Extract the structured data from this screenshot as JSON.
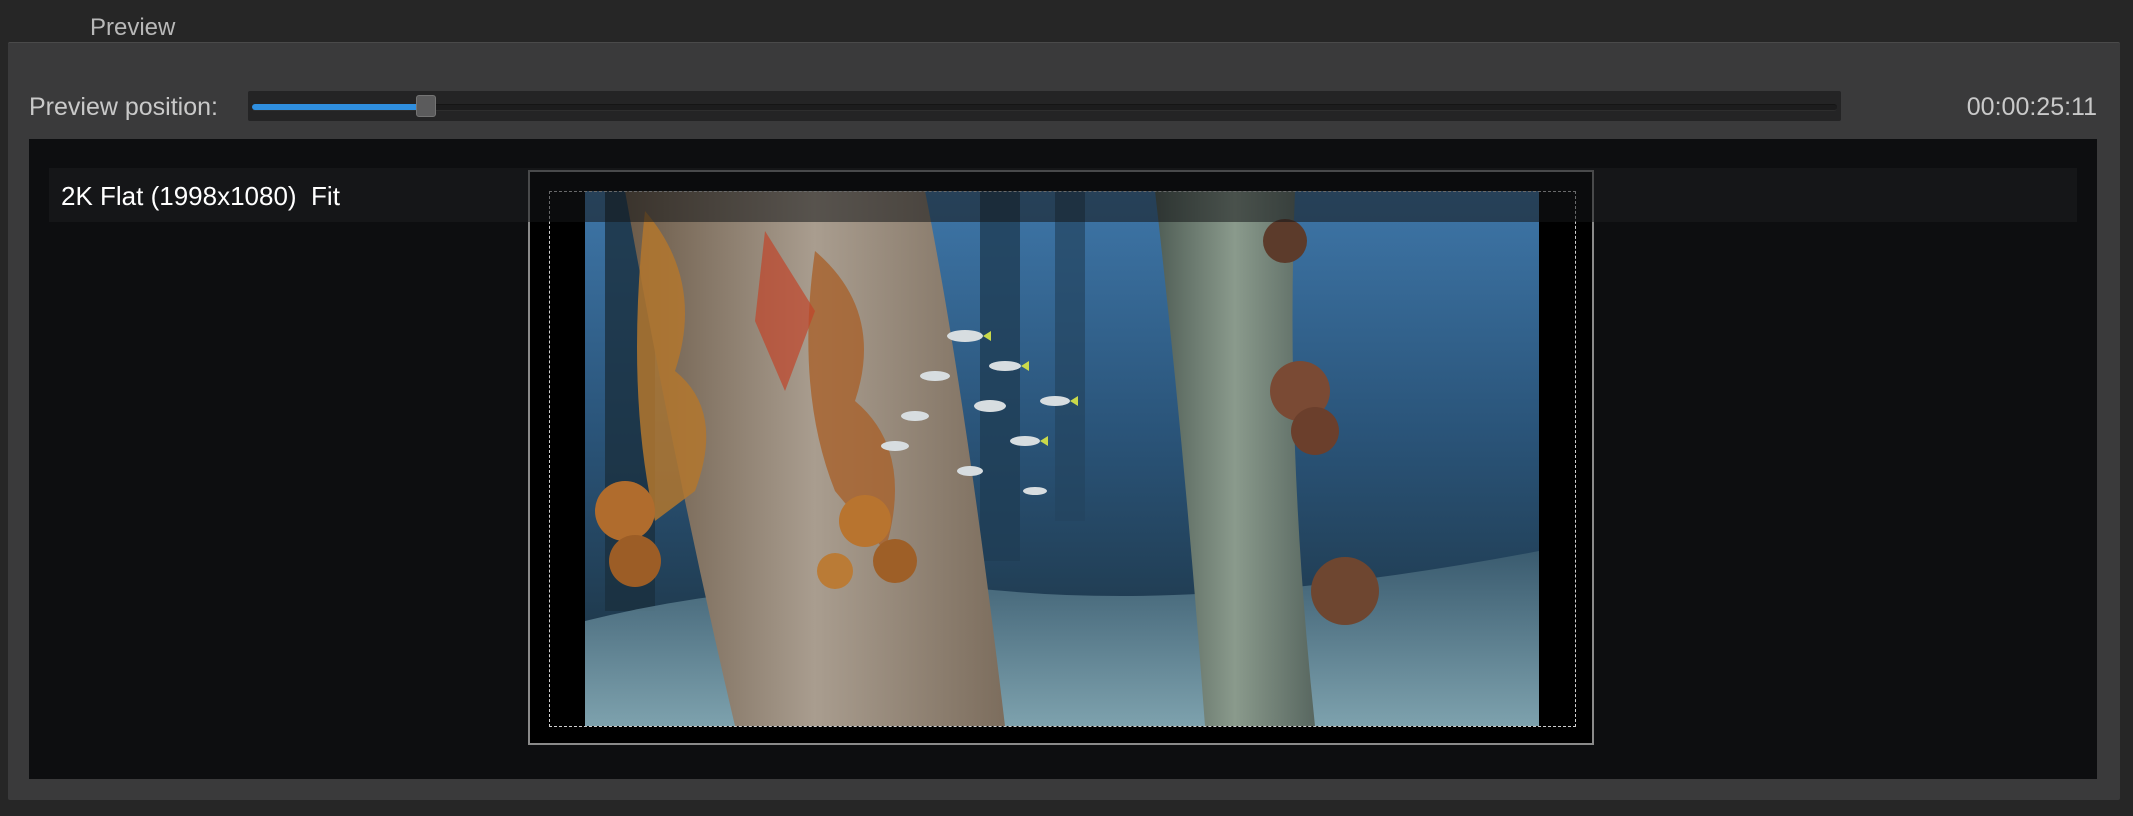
{
  "header": {
    "title": "Preview"
  },
  "preview_position": {
    "label": "Preview position:",
    "progress": 0.11,
    "timecode": "00:00:25:11"
  },
  "viewer": {
    "format_label": "2K Flat (1998x1080)  Fit",
    "image": "underwater pier pilings with coral and school of fish"
  },
  "colors": {
    "accent": "#2f8fe0",
    "panel": "#3a3a3b",
    "viewer_bg": "#0d0e10"
  }
}
